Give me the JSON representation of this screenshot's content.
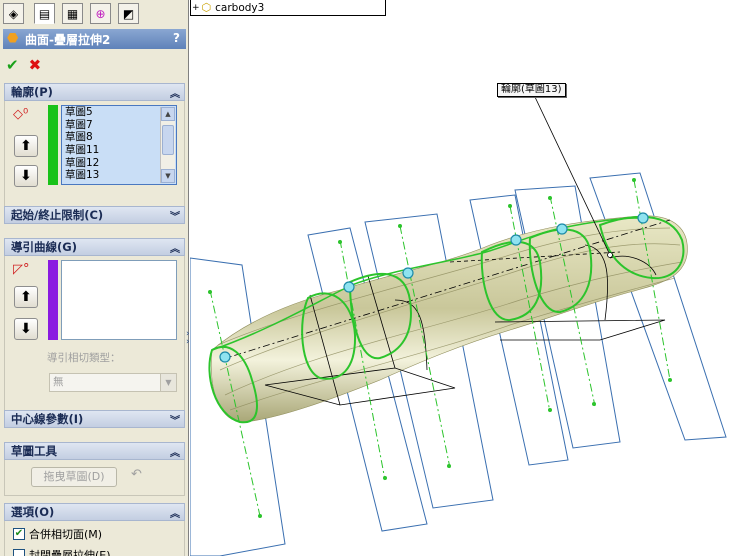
{
  "tabs": [
    {
      "name": "feature-manager-tab-icon",
      "glyph": "◈"
    },
    {
      "name": "property-manager-tab-icon",
      "glyph": "▤"
    },
    {
      "name": "configuration-manager-tab-icon",
      "glyph": "▦"
    },
    {
      "name": "dimxpert-tab-icon",
      "glyph": "⊕"
    },
    {
      "name": "display-manager-tab-icon",
      "glyph": "◩"
    }
  ],
  "header": {
    "title": "曲面-疊層拉伸2",
    "help": "?"
  },
  "actions": {
    "ok_glyph": "✔",
    "cancel_glyph": "✖"
  },
  "profiles": {
    "label": "輪廓(P)",
    "items": [
      "草圖5",
      "草圖7",
      "草圖8",
      "草圖11",
      "草圖12",
      "草圖13"
    ],
    "up_glyph": "⬆",
    "down_glyph": "⬇"
  },
  "start_end": {
    "label": "起始/終止限制(C)"
  },
  "guide_curves": {
    "label": "導引曲線(G)",
    "tangency_label": "導引相切類型：",
    "tangency_value": "無",
    "up_glyph": "⬆",
    "down_glyph": "⬇"
  },
  "centerline": {
    "label": "中心線參數(I)"
  },
  "sketch_tools": {
    "label": "草圖工具",
    "drag_button": "拖曳草圖(D)",
    "undo_glyph": "↶"
  },
  "options": {
    "label": "選項(O)",
    "merge_tangent": "合併相切面(M)",
    "merge_checked": true,
    "close_loft": "封閉疊層拉伸(E)"
  },
  "tree": {
    "node_label": "carbody3"
  },
  "callout": {
    "label": "輪廓(草圖13)"
  },
  "colors": {
    "accent_green": "#19c219",
    "accent_purple": "#8a1ae0",
    "plane_blue": "#3a6fb0",
    "curve_green": "#2cc42c",
    "point_cyan": "#25b8d8"
  }
}
